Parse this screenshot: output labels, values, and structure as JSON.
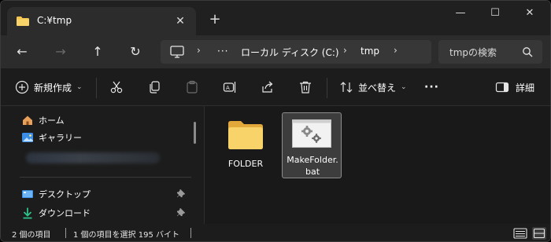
{
  "tab": {
    "title": "C:¥tmp",
    "close_glyph": "✕",
    "new_tab_glyph": "+"
  },
  "window": {
    "minimize_glyph": "—",
    "maximize_glyph": "☐",
    "close_glyph": "✕"
  },
  "nav": {
    "back_glyph": "←",
    "forward_glyph": "→",
    "up_glyph": "↑",
    "refresh_glyph": "↻"
  },
  "address": {
    "separator": "›",
    "overflow": "···",
    "segments": [
      "ローカル ディスク (C:)",
      "tmp"
    ]
  },
  "search": {
    "placeholder": "tmpの検索"
  },
  "commands": {
    "new_label": "新規作成",
    "sort_label": "並べ替え",
    "more_label": "···",
    "details_label": "詳細"
  },
  "sidebar": {
    "items": [
      {
        "label": "ホーム",
        "icon": "home-icon"
      },
      {
        "label": "ギャラリー",
        "icon": "gallery-icon"
      }
    ],
    "pinned": [
      {
        "label": "デスクトップ",
        "icon": "desktop-icon"
      },
      {
        "label": "ダウンロード",
        "icon": "download-icon"
      }
    ],
    "pin_glyph": "📌"
  },
  "files": [
    {
      "name": "FOLDER",
      "type": "folder",
      "selected": false
    },
    {
      "name": "MakeFolder.bat",
      "type": "batch-file",
      "selected": true
    }
  ],
  "status": {
    "item_count": "2 個の項目",
    "selection": "1 個の項目を選択  195 バイト"
  },
  "colors": {
    "accent": "#3a8ee6",
    "folder_yellow": "#f4c64e",
    "background": "#1c1c1c"
  }
}
